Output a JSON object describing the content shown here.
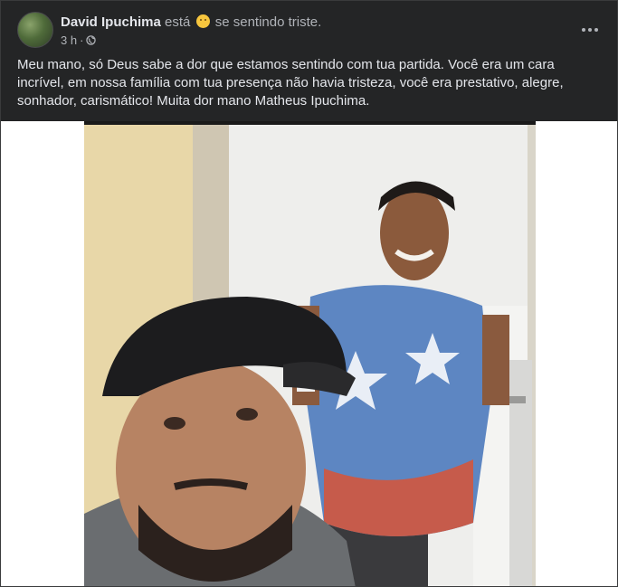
{
  "post": {
    "author": "David Ipuchima",
    "feeling_prefix": "está",
    "feeling_icon": "sad-face-emoji-icon",
    "feeling_text": "se sentindo triste.",
    "time": "3 h",
    "separator": "·",
    "privacy_icon": "globe-icon",
    "more_icon": "more-horizontal-icon",
    "text": "Meu mano, só Deus sabe a dor que estamos sentindo com tua partida.  Você era um cara incrível, em nossa família com tua presença não havia tristeza, você era prestativo, alegre, sonhador, carismático! Muita dor mano Matheus Ipuchima."
  },
  "colors": {
    "card_bg": "#242526",
    "primary_text": "#e4e6eb",
    "secondary_text": "#b0b3b8"
  }
}
